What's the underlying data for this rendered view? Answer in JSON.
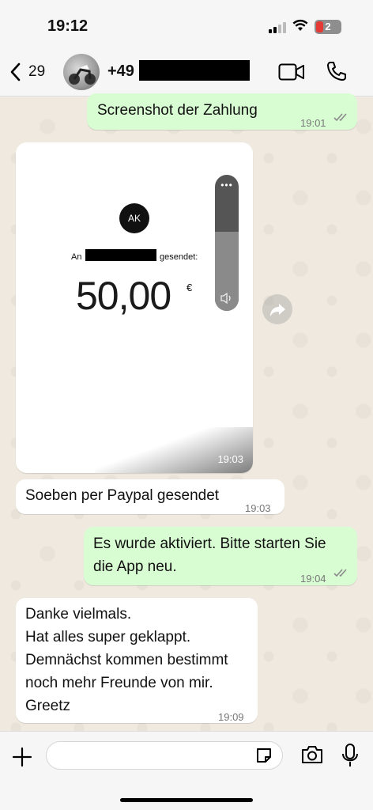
{
  "status_bar": {
    "time": "19:12",
    "battery": "2"
  },
  "header": {
    "back_count": "29",
    "contact_prefix": "+49"
  },
  "messages": [
    {
      "text": "Screenshot der Zahlung",
      "time": "19:01"
    },
    {
      "image": {
        "avatar_initials": "AK",
        "an": "An",
        "gesendet": "gesendet:",
        "amount": "50,00",
        "currency": "€",
        "volume_level": 0.58,
        "time": "19:03"
      }
    },
    {
      "text": "Soeben per Paypal gesendet",
      "time": "19:03"
    },
    {
      "line1": "Es wurde aktiviert. Bitte starten Sie",
      "line2": "die App neu.",
      "time": "19:04"
    },
    {
      "line1": "Danke vielmals.",
      "line2": "Hat alles super geklappt.",
      "line3": "Demnächst kommen bestimmt",
      "line4": "noch mehr Freunde von mir.",
      "line5": "Greetz",
      "time": "19:09"
    }
  ],
  "input": {
    "value": "",
    "placeholder": ""
  },
  "icons": [
    "back-chevron-icon",
    "video-call-icon",
    "phone-icon",
    "forward-icon",
    "plus-icon",
    "sticker-icon",
    "camera-icon",
    "mic-icon"
  ],
  "colors": {
    "outgoing_bubble": "#d9fdd3",
    "incoming_bubble": "#ffffff",
    "chat_background": "#efeae2"
  }
}
